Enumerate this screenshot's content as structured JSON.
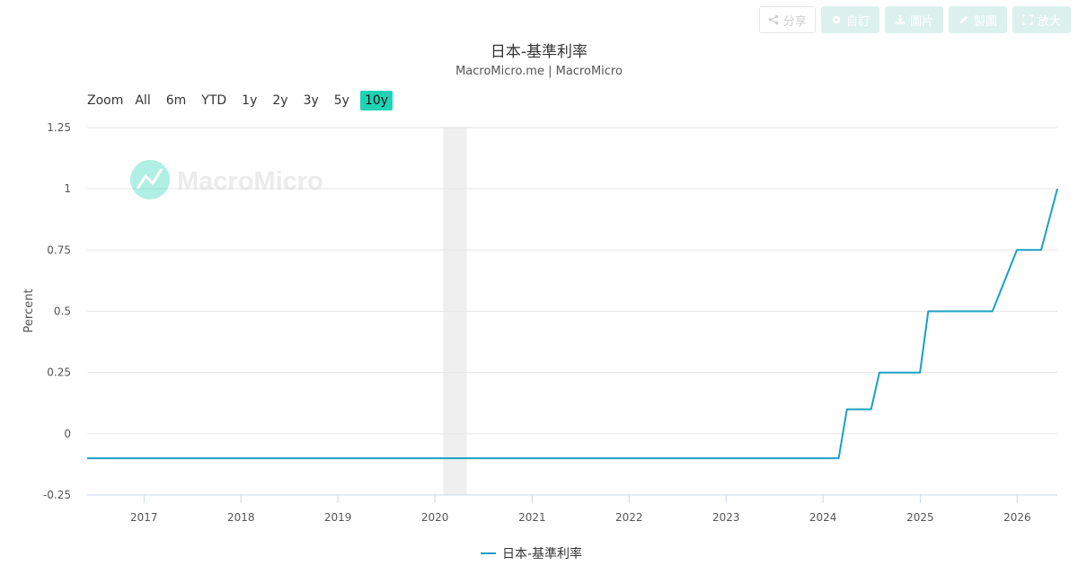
{
  "toolbar": {
    "share": "分享",
    "subscribe": "自訂",
    "image": "圖片",
    "draw": "製圖",
    "expand": "放大"
  },
  "title": "日本-基準利率",
  "subtitle": "MacroMicro.me | MacroMicro",
  "watermark": "MacroMicro",
  "zoom": {
    "label": "Zoom",
    "buttons": [
      "All",
      "6m",
      "YTD",
      "1y",
      "2y",
      "3y",
      "5y",
      "10y"
    ],
    "active": "10y"
  },
  "colors": {
    "series": "#1aa0c4",
    "accent": "#1fd3b4",
    "recession": "#efefef",
    "grid": "#e6e6e6"
  },
  "chart_data": {
    "type": "line",
    "title": "日本-基準利率",
    "ylabel": "Percent",
    "xlabel": "",
    "xlim": [
      "2016-06-01",
      "2026-06-01"
    ],
    "ylim": [
      -0.25,
      1.25
    ],
    "yticks": [
      -0.25,
      0,
      0.25,
      0.5,
      0.75,
      1,
      1.25
    ],
    "ytick_labels": [
      "-0.25",
      "0",
      "0.25",
      "0.5",
      "0.75",
      "1",
      "1.25"
    ],
    "xticks": [
      "2017",
      "2018",
      "2019",
      "2020",
      "2021",
      "2022",
      "2023",
      "2024",
      "2025",
      "2026"
    ],
    "grid": true,
    "legend_position": "bottom-center",
    "shaded_regions": [
      {
        "from": "2020-02-01",
        "to": "2020-04-30"
      }
    ],
    "series": [
      {
        "name": "日本-基準利率",
        "x": [
          "2016-06-01",
          "2024-02-29",
          "2024-03-31",
          "2024-06-30",
          "2024-07-31",
          "2024-12-31",
          "2025-01-31",
          "2025-09-30",
          "2025-12-31",
          "2026-04-01",
          "2026-06-01"
        ],
        "values": [
          -0.1,
          -0.1,
          0.1,
          0.1,
          0.25,
          0.25,
          0.5,
          0.5,
          0.75,
          0.75,
          1.0
        ]
      }
    ]
  }
}
